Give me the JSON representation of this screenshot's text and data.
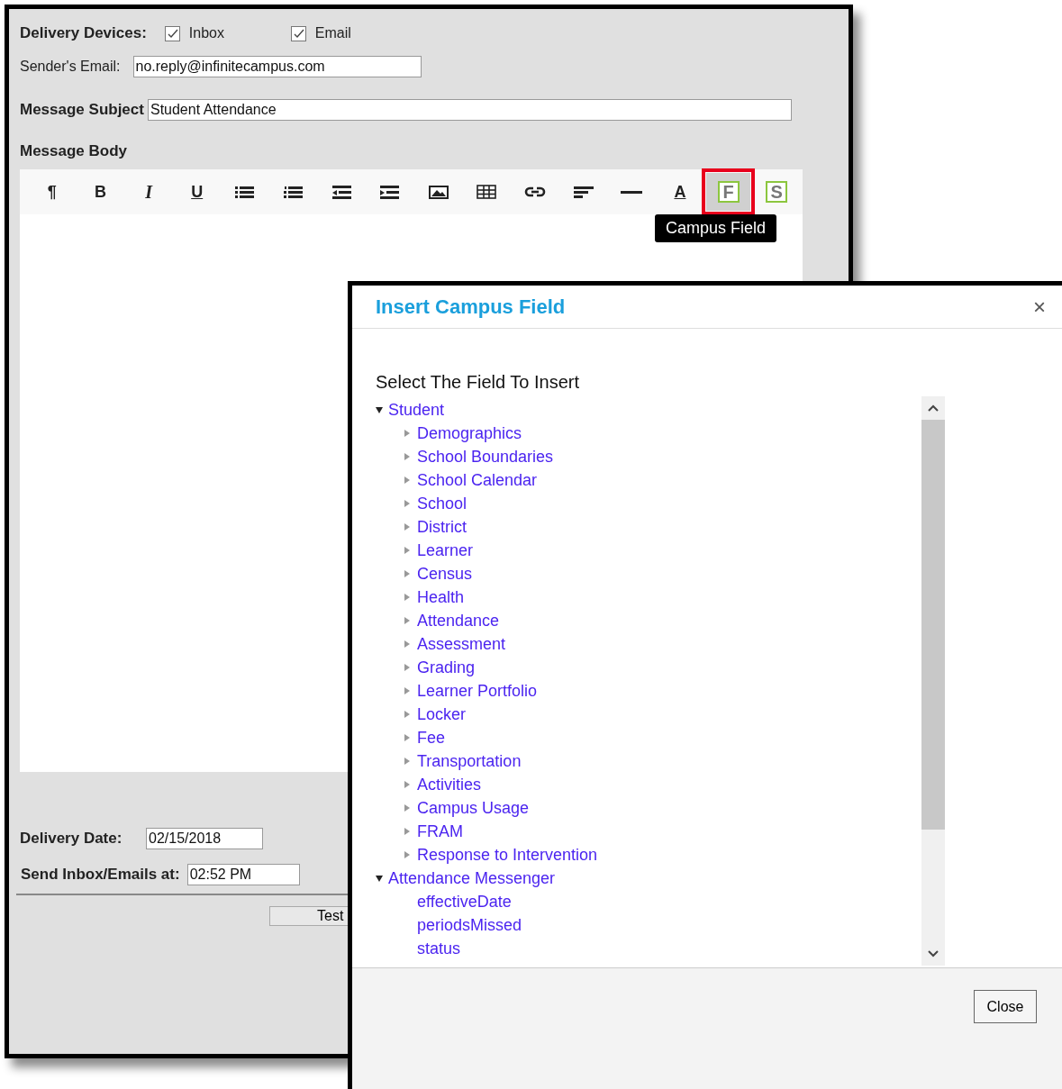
{
  "message_form": {
    "delivery_devices": {
      "label": "Delivery Devices:",
      "options": [
        {
          "label": "Inbox",
          "checked": true
        },
        {
          "label": "Email",
          "checked": true
        }
      ]
    },
    "senders_email": {
      "label": "Sender's Email:",
      "value": "no.reply@infinitecampus.com"
    },
    "message_subject": {
      "label": "Message Subject",
      "value": "Student Attendance"
    },
    "message_body": {
      "label": "Message Body",
      "toolbar": [
        {
          "kind": "paragraph",
          "label": "¶",
          "highlighted": false
        },
        {
          "kind": "bold",
          "label": "B",
          "highlighted": false
        },
        {
          "kind": "italic",
          "label": "I",
          "highlighted": false
        },
        {
          "kind": "underline",
          "label": "U",
          "highlighted": false
        },
        {
          "kind": "bullet-list",
          "highlighted": false
        },
        {
          "kind": "numbered-list",
          "highlighted": false
        },
        {
          "kind": "outdent",
          "highlighted": false
        },
        {
          "kind": "indent",
          "highlighted": false
        },
        {
          "kind": "image",
          "highlighted": false
        },
        {
          "kind": "table",
          "highlighted": false
        },
        {
          "kind": "link",
          "highlighted": false
        },
        {
          "kind": "align",
          "highlighted": false
        },
        {
          "kind": "rule",
          "highlighted": false
        },
        {
          "kind": "font-color",
          "label": "A",
          "highlighted": false
        },
        {
          "kind": "field",
          "label": "F",
          "highlighted": true
        },
        {
          "kind": "field",
          "label": "S",
          "highlighted": false
        }
      ],
      "tooltip": "Campus Field"
    },
    "delivery_date": {
      "label": "Delivery Date:",
      "value": "02/15/2018"
    },
    "send_at": {
      "label": "Send Inbox/Emails at:",
      "value": "02:52 PM"
    },
    "buttons": [
      "Test"
    ]
  },
  "dialog": {
    "title": "Insert Campus Field",
    "close_icon": "×",
    "heading": "Select The Field To Insert",
    "tree": [
      {
        "label": "Student",
        "expanded": true,
        "children": [
          {
            "label": "Demographics",
            "expanded": false
          },
          {
            "label": "School Boundaries",
            "expanded": false
          },
          {
            "label": "School Calendar",
            "expanded": false
          },
          {
            "label": "School",
            "expanded": false
          },
          {
            "label": "District",
            "expanded": false
          },
          {
            "label": "Learner",
            "expanded": false
          },
          {
            "label": "Census",
            "expanded": false
          },
          {
            "label": "Health",
            "expanded": false
          },
          {
            "label": "Attendance",
            "expanded": false
          },
          {
            "label": "Assessment",
            "expanded": false
          },
          {
            "label": "Grading",
            "expanded": false
          },
          {
            "label": "Learner Portfolio",
            "expanded": false
          },
          {
            "label": "Locker",
            "expanded": false
          },
          {
            "label": "Fee",
            "expanded": false
          },
          {
            "label": "Transportation",
            "expanded": false
          },
          {
            "label": "Activities",
            "expanded": false
          },
          {
            "label": "Campus Usage",
            "expanded": false
          },
          {
            "label": "FRAM",
            "expanded": false
          },
          {
            "label": "Response to Intervention",
            "expanded": false
          }
        ]
      },
      {
        "label": "Attendance Messenger",
        "expanded": true,
        "children": [
          {
            "label": "effectiveDate"
          },
          {
            "label": "periodsMissed"
          },
          {
            "label": "status"
          }
        ]
      }
    ],
    "buttons": [
      "Close"
    ]
  }
}
